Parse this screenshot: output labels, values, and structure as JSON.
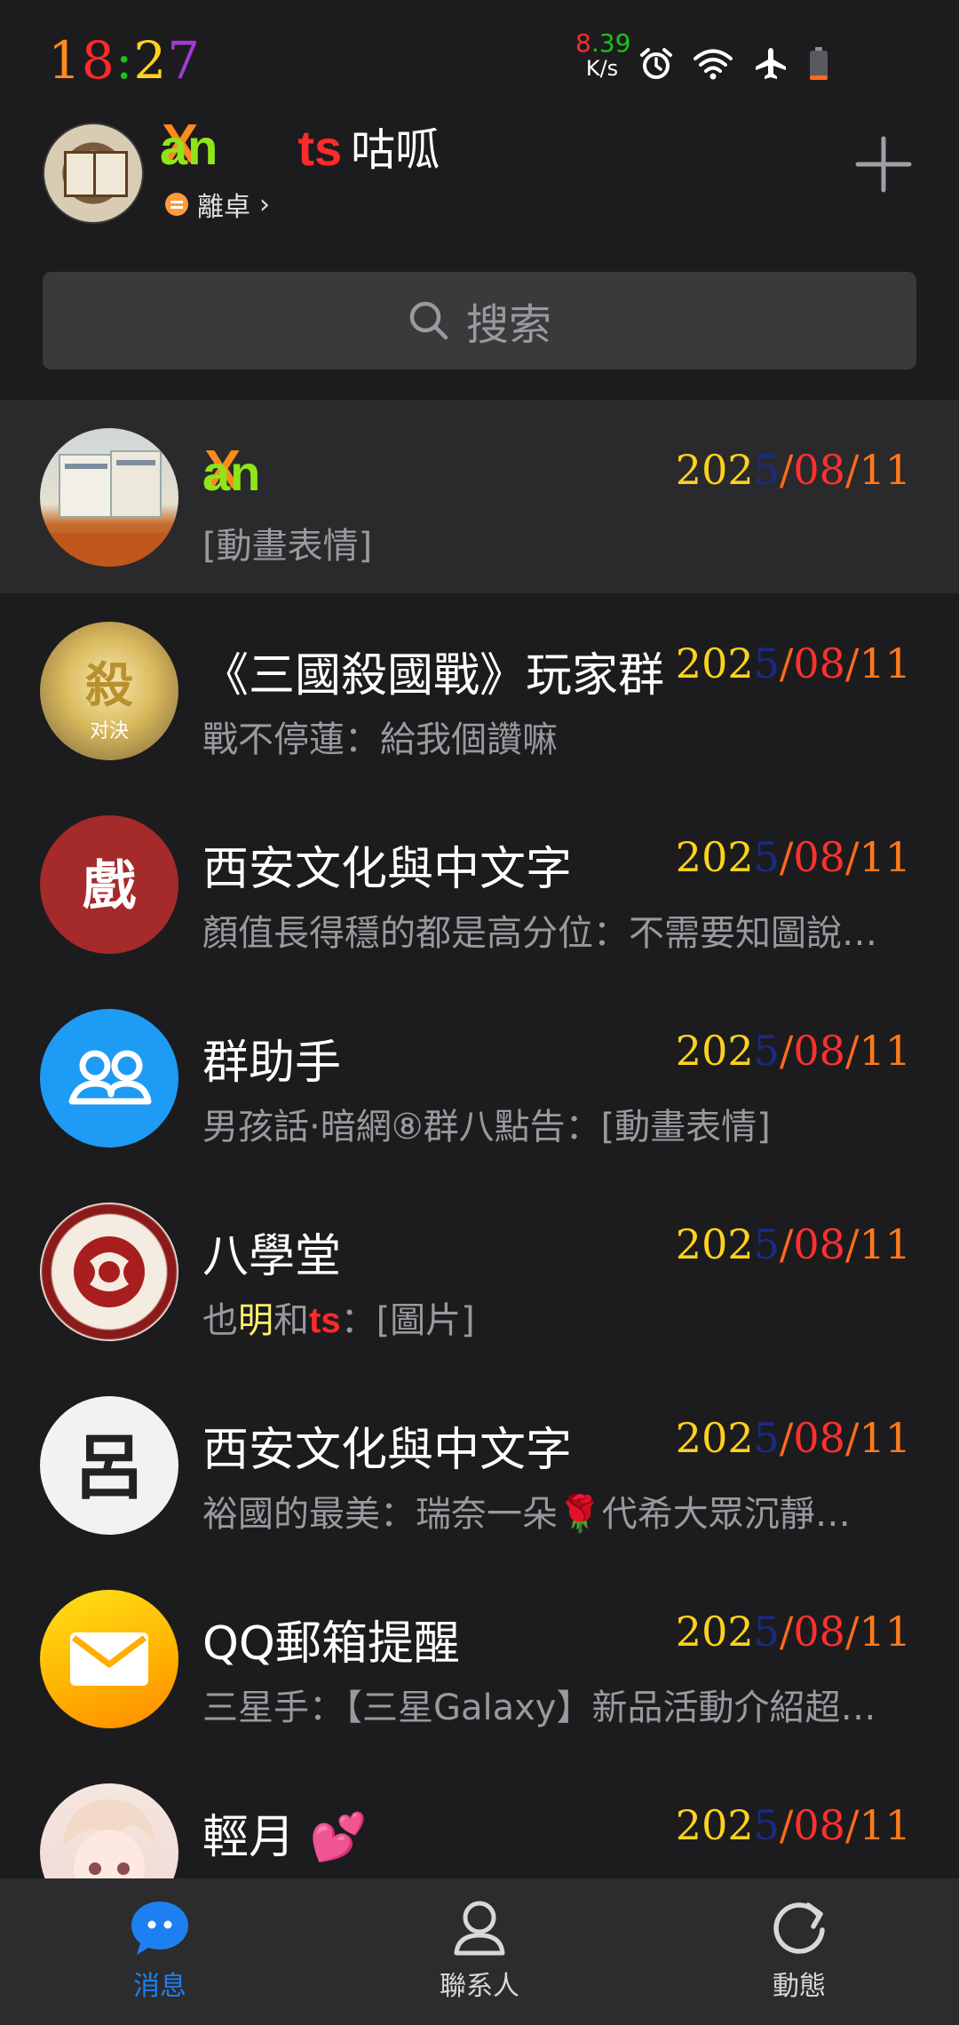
{
  "status_bar": {
    "time_parts": [
      {
        "text": "1",
        "color": "#ff8a1c"
      },
      {
        "text": "8",
        "color": "#ff2a2a"
      },
      {
        "text": ":",
        "color": "#19c219"
      },
      {
        "text": "2",
        "color": "#ffd21c"
      },
      {
        "text": "7",
        "color": "#a23bd6"
      }
    ],
    "net_speed_parts": [
      {
        "text": "8",
        "color": "#ff2a2a"
      },
      {
        "text": ".",
        "color": "#19c219"
      },
      {
        "text": "3",
        "color": "#19c219"
      },
      {
        "text": "9",
        "color": "#19c219"
      }
    ],
    "net_unit": "K/s",
    "icons": [
      "alarm-icon",
      "wifi-icon",
      "airplane-icon",
      "battery-icon"
    ],
    "battery_level": 0.15
  },
  "header": {
    "logo_x": "X",
    "logo_an": "an",
    "ts": "ts",
    "nickname_rest": "咕呱",
    "status_text": "離卓",
    "status_chevron": "›"
  },
  "search": {
    "placeholder": "搜索"
  },
  "chats": [
    {
      "name_is_logo": true,
      "name_x": "X",
      "name_an": "an",
      "preview": "[動畫表情]",
      "date_parts": [
        "20",
        "2",
        "5",
        "/",
        "08",
        "/",
        "11"
      ]
    },
    {
      "name": "《三國殺國戰》玩家群",
      "preview": "戰不停蓮：給我個讚嘛",
      "date_parts": [
        "20",
        "2",
        "5",
        "/",
        "08",
        "/",
        "11"
      ]
    },
    {
      "name": "西安文化與中文字",
      "preview": "顏值長得穩的都是高分位：不需要知圖說話吧…",
      "date_parts": [
        "20",
        "2",
        "5",
        "/",
        "08",
        "/",
        "11"
      ]
    },
    {
      "name": "群助手",
      "preview": "男孩話·暗網⑧群八點告：[動畫表情]",
      "date_parts": [
        "20",
        "2",
        "5",
        "/",
        "08",
        "/",
        "11"
      ]
    },
    {
      "name": "八學堂",
      "preview_prefix": "也",
      "preview_yellow": "明",
      "preview_mid": "和",
      "preview_ts": "ts",
      "preview_suffix": "：[圖片]",
      "date_parts": [
        "20",
        "2",
        "5",
        "/",
        "08",
        "/",
        "11"
      ]
    },
    {
      "name": "西安文化與中文字",
      "preview": "裕國的最美：瑞奈一朵🌹代希大眾沉靜精采觀摩…",
      "date_parts": [
        "20",
        "2",
        "5",
        "/",
        "08",
        "/",
        "11"
      ]
    },
    {
      "name": "QQ郵箱提醒",
      "preview": "三星手：【三星Galaxy】新品活動介紹超值…",
      "date_parts": [
        "20",
        "2",
        "5",
        "/",
        "08",
        "/",
        "11"
      ]
    },
    {
      "name": "輕月 💕",
      "preview": "",
      "date_parts": [
        "20",
        "2",
        "5",
        "/",
        "08",
        "/",
        "11"
      ]
    }
  ],
  "bottom_nav": {
    "items": [
      {
        "label": "消息",
        "icon": "chat-bubble-icon",
        "active": true
      },
      {
        "label": "聯系人",
        "icon": "contacts-icon",
        "active": false
      },
      {
        "label": "動態",
        "icon": "refresh-icon",
        "active": false
      }
    ],
    "active_color": "#1e7ff0",
    "inactive_color": "#d8d8d8"
  }
}
